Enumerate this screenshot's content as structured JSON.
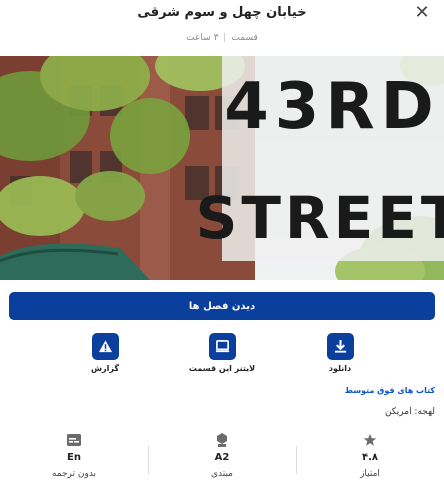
{
  "header": {
    "title": "خیابان چهل و سوم شرقی",
    "close_icon": "close-icon",
    "meta_episodes": "قسمت",
    "meta_duration": "۳ ساعت"
  },
  "hero": {
    "sign_line1": "43RD",
    "sign_line2": "STREET"
  },
  "watch_button": {
    "label": "دیدن فصل ها"
  },
  "actions": [
    {
      "icon": "download-icon",
      "label": "دانلود"
    },
    {
      "icon": "laptop-icon",
      "label": "لایتنر این قسمت"
    },
    {
      "icon": "warning-icon",
      "label": "گزارش"
    }
  ],
  "level_link": "کتاب های فوق متوسط",
  "dialect": "لهجه: امریکن",
  "stats": [
    {
      "icon": "star-icon",
      "value": "۴.۸",
      "caption": "امتیاز"
    },
    {
      "icon": "level-icon",
      "value": "A2",
      "caption": "مبتدی"
    },
    {
      "icon": "subtitle-icon",
      "value": "En",
      "caption": "بدون ترجمه"
    }
  ],
  "colors": {
    "primary": "#0b3f9d",
    "link": "#0b57c9"
  }
}
